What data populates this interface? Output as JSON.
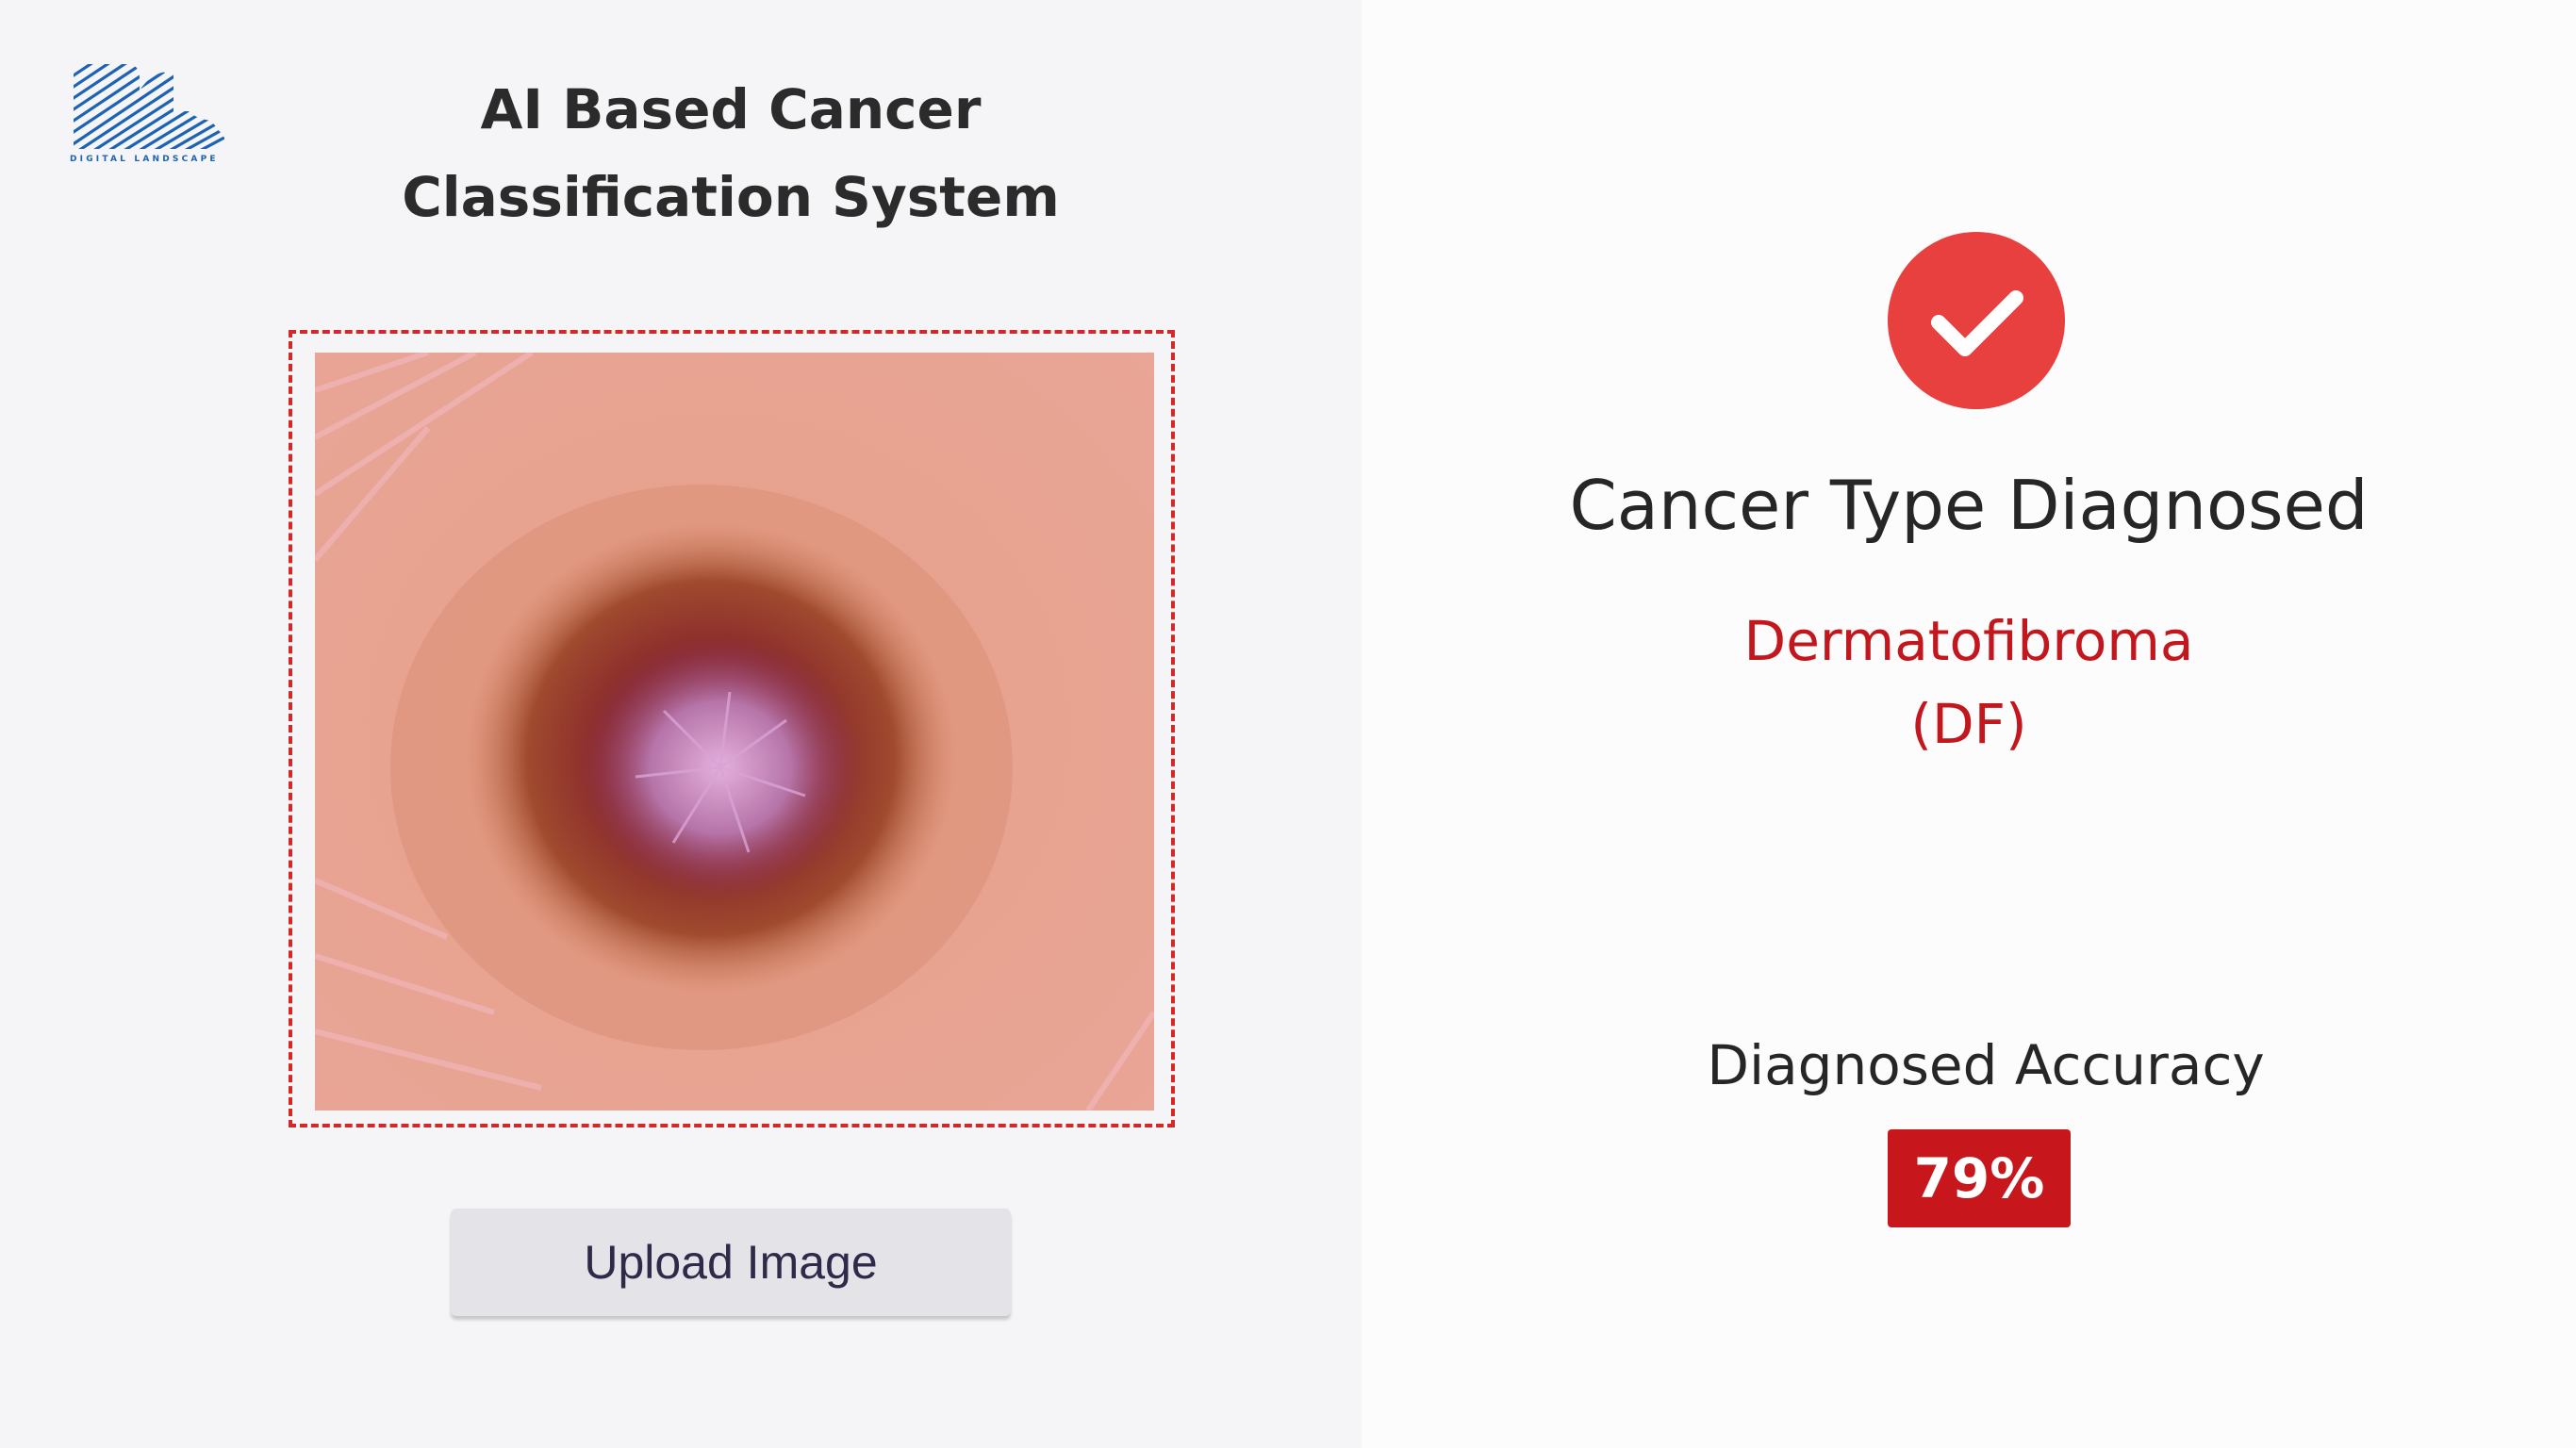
{
  "branding": {
    "logo_text": "DIGITAL LANDSCAPE",
    "logo_color": "#1d63b3"
  },
  "header": {
    "title_line1": "AI Based Cancer",
    "title_line2": "Classification System"
  },
  "upload": {
    "button_label": "Upload Image",
    "frame_color": "#d42727"
  },
  "result": {
    "status_icon": "check-icon",
    "heading": "Cancer Type Diagnosed",
    "diagnosis_name": "Dermatofibroma",
    "diagnosis_code": "(DF)",
    "accuracy_label": "Diagnosed Accuracy",
    "accuracy_value": "79%",
    "accent_color": "#c8171c"
  }
}
